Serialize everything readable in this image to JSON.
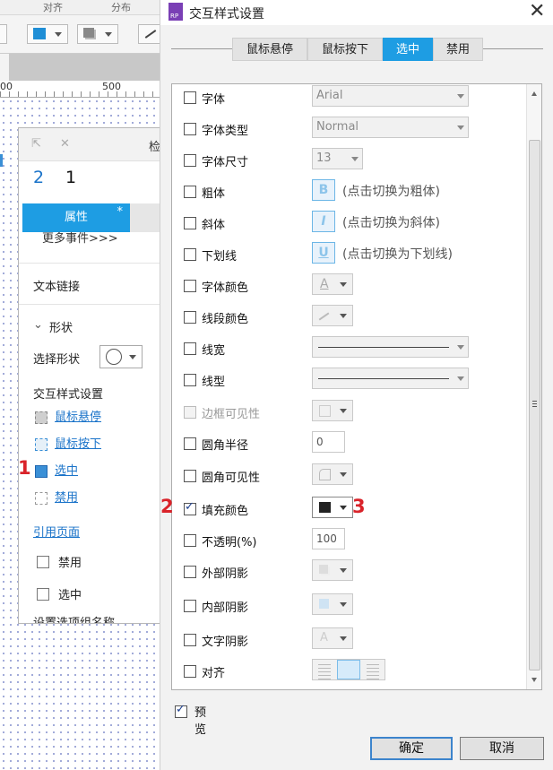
{
  "background_app": {
    "menu": [
      "对齐",
      "分布"
    ],
    "ruler_label": "500",
    "ruler_left": "00",
    "panel": {
      "title": "检",
      "nums": [
        "2",
        "1"
      ],
      "tab_label": "属性",
      "tab_star": "*",
      "more_events": "更多事件>>>",
      "text_link": "文本链接",
      "shape_section": "形状",
      "select_shape": "选择形状",
      "interaction_title": "交互样式设置",
      "links": [
        "鼠标悬停",
        "鼠标按下",
        "选中",
        "禁用"
      ],
      "ref_page": "引用页面",
      "checkboxes": [
        "禁用",
        "选中"
      ],
      "cut_text": "设置选项组名称"
    }
  },
  "annotations": {
    "m1": "1",
    "m2": "2",
    "m3": "3"
  },
  "dialog": {
    "title": "交互样式设置",
    "logo": "RP",
    "tabs": [
      {
        "label": "鼠标悬停",
        "active": false
      },
      {
        "label": "鼠标按下",
        "active": false
      },
      {
        "label": "选中",
        "active": true
      },
      {
        "label": "禁用",
        "active": false
      }
    ],
    "rows": [
      {
        "label": "字体",
        "checked": false,
        "value": "Arial"
      },
      {
        "label": "字体类型",
        "checked": false,
        "value": "Normal"
      },
      {
        "label": "字体尺寸",
        "checked": false,
        "value": "13"
      },
      {
        "label": "粗体",
        "checked": false,
        "icon": "B",
        "hint": "(点击切换为粗体)"
      },
      {
        "label": "斜体",
        "checked": false,
        "icon": "I",
        "hint": "(点击切换为斜体)"
      },
      {
        "label": "下划线",
        "checked": false,
        "icon": "U",
        "hint": "(点击切换为下划线)"
      },
      {
        "label": "字体颜色",
        "checked": false
      },
      {
        "label": "线段颜色",
        "checked": false
      },
      {
        "label": "线宽",
        "checked": false
      },
      {
        "label": "线型",
        "checked": false
      },
      {
        "label": "边框可见性",
        "checked": false,
        "disabled": true
      },
      {
        "label": "圆角半径",
        "checked": false,
        "value": "0"
      },
      {
        "label": "圆角可见性",
        "checked": false
      },
      {
        "label": "填充颜色",
        "checked": true,
        "color": "#222222"
      },
      {
        "label": "不透明(%)",
        "checked": false,
        "value": "100"
      },
      {
        "label": "外部阴影",
        "checked": false
      },
      {
        "label": "内部阴影",
        "checked": false
      },
      {
        "label": "文字阴影",
        "checked": false
      },
      {
        "label": "对齐",
        "checked": false
      }
    ],
    "preview": {
      "label": "预览",
      "checked": true
    },
    "ok": "确定",
    "cancel": "取消",
    "accent": "#1e9de3"
  }
}
